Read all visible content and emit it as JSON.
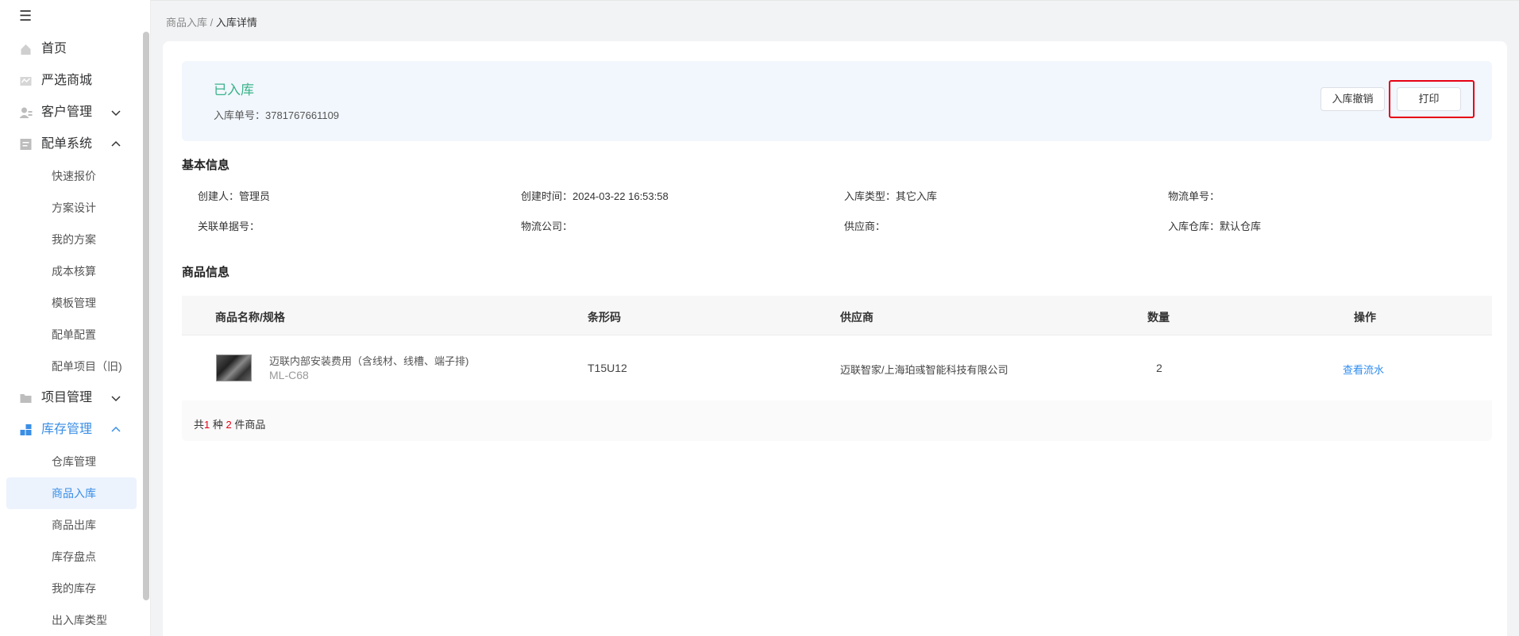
{
  "sidebar": {
    "items": [
      {
        "label": "首页",
        "icon": "home-icon"
      },
      {
        "label": "严选商城",
        "icon": "mall-icon"
      },
      {
        "label": "客户管理",
        "icon": "customer-icon",
        "arrow": "down"
      },
      {
        "label": "配单系统",
        "icon": "order-system-icon",
        "arrow": "up"
      }
    ],
    "order_sub": [
      "快速报价",
      "方案设计",
      "我的方案",
      "成本核算",
      "模板管理",
      "配单配置",
      "配单项目（旧)"
    ],
    "project": {
      "label": "项目管理",
      "icon": "folder-icon",
      "arrow": "down"
    },
    "inventory": {
      "label": "库存管理",
      "icon": "inventory-icon",
      "arrow": "up"
    },
    "inventory_sub": [
      "仓库管理",
      "商品入库",
      "商品出库",
      "库存盘点",
      "我的库存",
      "出入库类型"
    ]
  },
  "breadcrumb": {
    "parent": "商品入库",
    "separator": "/",
    "current": "入库详情"
  },
  "status": {
    "title": "已入库",
    "order_no_label": "入库单号：",
    "order_no": "3781767661109",
    "undo_label": "入库撤销",
    "print_label": "打印"
  },
  "basic": {
    "title": "基本信息",
    "creator": "创建人：管理员",
    "created_time": "创建时间：2024-03-22 16:53:58",
    "in_type": "入库类型：其它入库",
    "logistics_no": "物流单号：",
    "related_no": "关联单据号：",
    "logistics_company": "物流公司：",
    "supplier": "供应商：",
    "warehouse": "入库仓库：默认仓库"
  },
  "goods": {
    "title": "商品信息",
    "headers": {
      "name": "商品名称/规格",
      "barcode": "条形码",
      "supplier": "供应商",
      "qty": "数量",
      "action": "操作"
    },
    "rows": [
      {
        "name": "迈联内部安装费用（含线材、线槽、端子排)",
        "spec": "ML-C68",
        "barcode": "T15U12",
        "supplier": "迈联智家/上海珀彧智能科技有限公司",
        "qty": "2",
        "action": "查看流水"
      }
    ],
    "footer": {
      "prefix": "共",
      "kinds": "1",
      "mid": " 种 ",
      "count": "2",
      "suffix": " 件商品"
    }
  },
  "colors": {
    "accent": "#3a8ee6",
    "status_green": "#3bb38a",
    "link": "#2d8cf0",
    "highlight_red": "#e60012"
  }
}
